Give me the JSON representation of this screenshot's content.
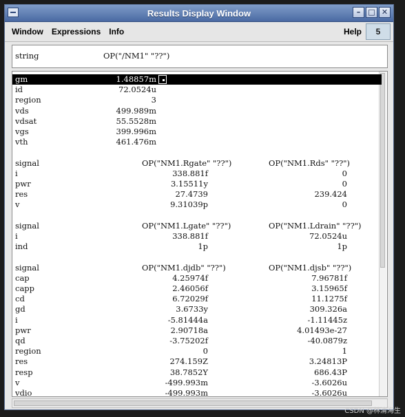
{
  "window": {
    "title": "Results Display Window"
  },
  "menu": {
    "items": [
      "Window",
      "Expressions",
      "Info"
    ],
    "help": "Help",
    "badge": "5"
  },
  "top": {
    "key": "string",
    "value": "OP(\"/NM1\" \"??\")"
  },
  "block1": {
    "rows": [
      {
        "k": "gm",
        "v": "1.48857m",
        "selected": true
      },
      {
        "k": "id",
        "v": "72.0524u"
      },
      {
        "k": "region",
        "v": "3"
      },
      {
        "k": "vds",
        "v": "499.989m"
      },
      {
        "k": "vdsat",
        "v": "55.5528m"
      },
      {
        "k": "vgs",
        "v": "399.996m"
      },
      {
        "k": "vth",
        "v": "461.476m"
      }
    ]
  },
  "block2": {
    "header": [
      "signal",
      "OP(\"NM1.Rgate\" \"??\")",
      "OP(\"NM1.Rds\" \"??\")"
    ],
    "rows": [
      [
        "i",
        "338.881f",
        "0"
      ],
      [
        "pwr",
        "3.15511y",
        "0"
      ],
      [
        "res",
        "27.4739",
        "239.424"
      ],
      [
        "v",
        "9.31039p",
        "0"
      ]
    ]
  },
  "block3": {
    "header": [
      "signal",
      "OP(\"NM1.Lgate\" \"??\")",
      "OP(\"NM1.Ldrain\" \"??\")"
    ],
    "rows": [
      [
        "i",
        "338.881f",
        "72.0524u"
      ],
      [
        "ind",
        "1p",
        "1p"
      ]
    ]
  },
  "block4": {
    "header": [
      "signal",
      "OP(\"NM1.djdb\" \"??\")",
      "OP(\"NM1.djsb\" \"??\")"
    ],
    "rows": [
      [
        "cap",
        "4.25974f",
        "7.96781f"
      ],
      [
        "capp",
        "2.46056f",
        "3.15965f"
      ],
      [
        "cd",
        "6.72029f",
        "11.1275f"
      ],
      [
        "gd",
        "3.6733y",
        "309.326a"
      ],
      [
        "i",
        "-5.81444a",
        "-1.11445z"
      ],
      [
        "pwr",
        "2.90718a",
        "4.01493e-27"
      ],
      [
        "qd",
        "-3.75202f",
        "-40.0879z"
      ],
      [
        "region",
        "0",
        "1"
      ],
      [
        "res",
        "274.159Z",
        "3.24813P"
      ],
      [
        "resp",
        "38.7852Y",
        "686.43P"
      ],
      [
        "v",
        "-499.993m",
        "-3.6026u"
      ],
      [
        "vdio",
        "-499.993m",
        "-3.6026u"
      ]
    ]
  },
  "watermark": "CSDN @林清海生"
}
